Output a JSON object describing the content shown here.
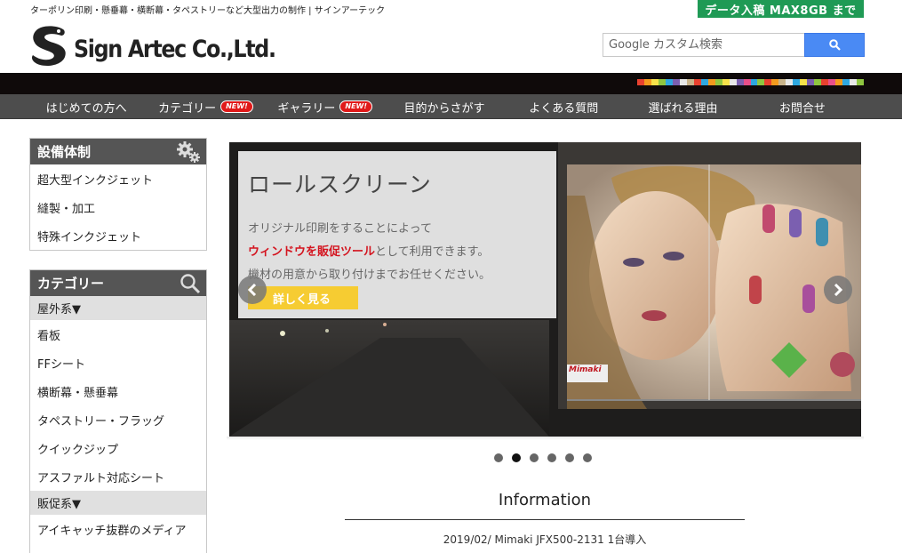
{
  "header": {
    "tagline": "ターポリン印刷・懸垂幕・横断幕・タペストリーなど大型出力の制作 | サインアーテック",
    "upload_banner": "データ入稿 MAX8GB まで",
    "logo_text": "Sign Artec Co.,Ltd.",
    "search_placeholder": "Google カスタム検索"
  },
  "colors": {
    "accent_green": "#1f9a55",
    "nav_bg": "#4d4d4d",
    "search_button": "#4a8af4",
    "highlight_red": "#d4141f",
    "button_yellow": "#f6cc32"
  },
  "nav": {
    "items": [
      {
        "label": "はじめての方へ"
      },
      {
        "label": "カテゴリー",
        "badge": "NEW!"
      },
      {
        "label": "ギャラリー",
        "badge": "NEW!"
      },
      {
        "label": "目的からさがす"
      },
      {
        "label": "よくある質問"
      },
      {
        "label": "選ばれる理由"
      },
      {
        "label": "お問合せ"
      }
    ]
  },
  "sidebar": {
    "equipment": {
      "title": "設備体制",
      "icon": "gears-icon",
      "items": [
        "超大型インクジェット",
        "縫製・加工",
        "特殊インクジェット"
      ]
    },
    "category": {
      "title": "カテゴリー",
      "icon": "search-icon",
      "outdoor_label": "屋外系▼",
      "outdoor_items": [
        "看板",
        "FFシート",
        "横断幕・懸垂幕",
        "タペストリー・フラッグ",
        "クイックジップ",
        "アスファルト対応シート"
      ],
      "promo_label": "販促系▼",
      "promo_items": [
        "アイキャッチ抜群のメディア"
      ]
    }
  },
  "slider": {
    "title": "ロールスクリーン",
    "line1": "オリジナル印刷をすることによって",
    "line2_red": "ウィンドウを販促ツール",
    "line2_rest": "として利用できます。",
    "line3": "機材の用意から取り付けまでお任せください。",
    "button": "詳しく見る",
    "brand_sign": "Mimaki",
    "dot_count": 6,
    "active_dot": 2
  },
  "information": {
    "title": "Information",
    "items": [
      "2019/02/ Mimaki JFX500-2131 1台導入"
    ]
  }
}
